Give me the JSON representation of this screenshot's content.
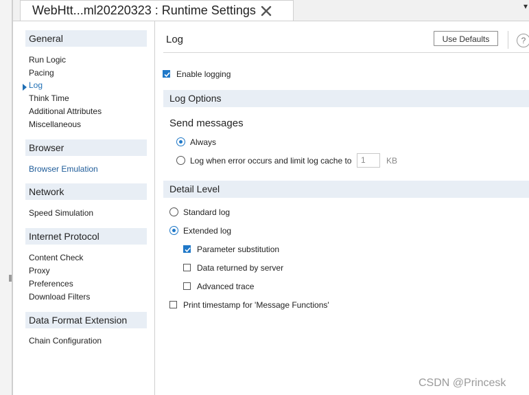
{
  "tab": {
    "title": "WebHtt...ml20220323 : Runtime Settings"
  },
  "nav": {
    "sections": [
      {
        "header": "General",
        "items": [
          "Run Logic",
          "Pacing",
          "Log",
          "Think Time",
          "Additional Attributes",
          "Miscellaneous"
        ]
      },
      {
        "header": "Browser",
        "items": [
          "Browser Emulation"
        ]
      },
      {
        "header": "Network",
        "items": [
          "Speed Simulation"
        ]
      },
      {
        "header": "Internet Protocol",
        "items": [
          "Content Check",
          "Proxy",
          "Preferences",
          "Download Filters"
        ]
      },
      {
        "header": "Data Format Extension",
        "items": [
          "Chain Configuration"
        ]
      }
    ],
    "selected": "Log"
  },
  "main": {
    "title": "Log",
    "use_defaults_label": "Use Defaults",
    "help_label": "?",
    "enable_logging": {
      "label": "Enable logging",
      "checked": true
    },
    "log_options": {
      "header": "Log Options",
      "send_messages_title": "Send messages",
      "always": {
        "label": "Always",
        "selected": true
      },
      "on_error": {
        "label": "Log when error occurs and limit log cache to",
        "selected": false,
        "value": "1",
        "unit": "KB"
      }
    },
    "detail_level": {
      "header": "Detail Level",
      "standard": {
        "label": "Standard log",
        "selected": false
      },
      "extended": {
        "label": "Extended log",
        "selected": true
      },
      "parameter_substitution": {
        "label": "Parameter substitution",
        "checked": true
      },
      "data_returned": {
        "label": "Data returned by server",
        "checked": false
      },
      "advanced_trace": {
        "label": "Advanced trace",
        "checked": false
      },
      "print_timestamp": {
        "label": "Print timestamp for 'Message Functions'",
        "checked": false
      }
    }
  },
  "watermark": "CSDN @Princesk",
  "colors": {
    "accent": "#1f78c8",
    "section_bg": "#e8eef5",
    "link": "#1f5c99"
  }
}
